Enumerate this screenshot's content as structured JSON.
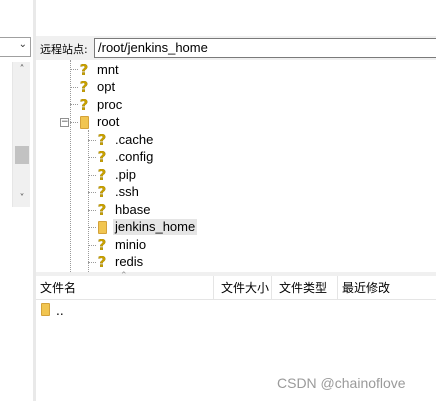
{
  "local_pane": {
    "combo_chevron_icon": "chevron-down-icon"
  },
  "remote": {
    "site_label": "远程站点:",
    "path_value": "/root/jenkins_home"
  },
  "tree": {
    "items": [
      {
        "label": "mnt",
        "icon": "unknown-folder-icon"
      },
      {
        "label": "opt",
        "icon": "unknown-folder-icon"
      },
      {
        "label": "proc",
        "icon": "unknown-folder-icon"
      },
      {
        "label": "root",
        "icon": "folder-icon",
        "expanded": true
      },
      {
        "label": ".cache",
        "icon": "unknown-folder-icon"
      },
      {
        "label": ".config",
        "icon": "unknown-folder-icon"
      },
      {
        "label": ".pip",
        "icon": "unknown-folder-icon"
      },
      {
        "label": ".ssh",
        "icon": "unknown-folder-icon"
      },
      {
        "label": "hbase",
        "icon": "unknown-folder-icon"
      },
      {
        "label": "jenkins_home",
        "icon": "folder-icon",
        "selected": true
      },
      {
        "label": "minio",
        "icon": "unknown-folder-icon"
      },
      {
        "label": "redis",
        "icon": "unknown-folder-icon"
      }
    ]
  },
  "file_list": {
    "columns": [
      "文件名",
      "文件大小",
      "文件类型",
      "最近修改"
    ],
    "rows": [
      {
        "name": "..",
        "icon": "folder-icon"
      }
    ]
  },
  "watermark": "CSDN @chainoflove",
  "colors": {
    "folder": "#f1c550",
    "unknown_marker": "#c8a000",
    "selection": "#e5e5e5"
  }
}
